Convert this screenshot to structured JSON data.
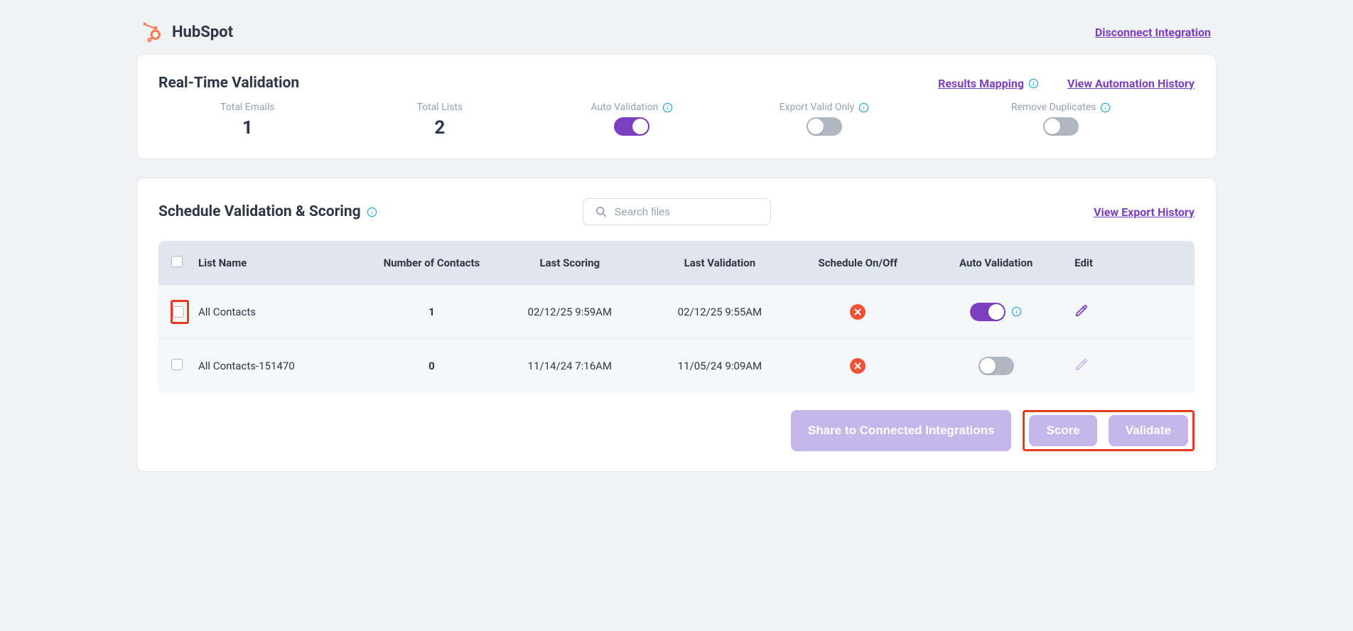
{
  "brand": {
    "name": "HubSpot"
  },
  "links": {
    "disconnect": "Disconnect Integration",
    "results_mapping": "Results Mapping",
    "automation_history": "View Automation History",
    "export_history": "View Export History"
  },
  "realtime": {
    "title": "Real-Time Validation",
    "total_emails_label": "Total Emails",
    "total_emails_value": "1",
    "total_lists_label": "Total Lists",
    "total_lists_value": "2",
    "auto_validation_label": "Auto Validation",
    "export_valid_label": "Export Valid Only",
    "remove_dup_label": "Remove Duplicates",
    "toggles": {
      "auto_validation": true,
      "export_valid": false,
      "remove_dup": false
    }
  },
  "schedule": {
    "title": "Schedule Validation & Scoring",
    "search_placeholder": "Search files",
    "columns": {
      "list_name": "List Name",
      "contacts": "Number of Contacts",
      "last_scoring": "Last Scoring",
      "last_validation": "Last Validation",
      "schedule": "Schedule On/Off",
      "auto_validation": "Auto Validation",
      "edit": "Edit"
    },
    "rows": [
      {
        "name": "All Contacts",
        "contacts": "1",
        "last_scoring": "02/12/25 9:59AM",
        "last_validation": "02/12/25 9:55AM",
        "auto_on": true,
        "pencil_color": "#7b3fbf",
        "highlighted": true
      },
      {
        "name": "All Contacts-151470",
        "contacts": "0",
        "last_scoring": "11/14/24 7:16AM",
        "last_validation": "11/05/24 9:09AM",
        "auto_on": false,
        "pencil_color": "#c9b9e6",
        "highlighted": false
      }
    ]
  },
  "buttons": {
    "share": "Share to Connected Integrations",
    "score": "Score",
    "validate": "Validate"
  }
}
